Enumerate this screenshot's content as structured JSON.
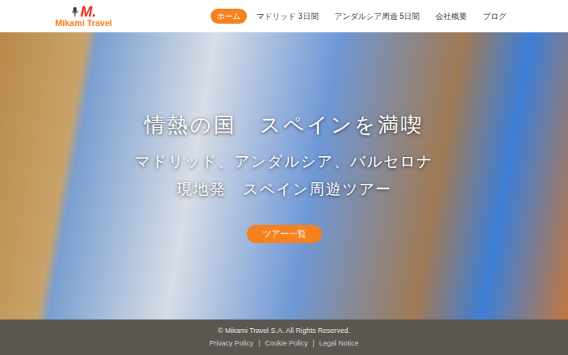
{
  "logo": {
    "mark": "M.",
    "name": "Mikami Travel"
  },
  "nav": [
    {
      "label": "ホーム",
      "selected": true
    },
    {
      "label": "マドリッド 3日間",
      "selected": false
    },
    {
      "label": "アンダルシア周遊 5日間",
      "selected": false
    },
    {
      "label": "会社概要",
      "selected": false
    },
    {
      "label": "ブログ",
      "selected": false
    }
  ],
  "hero": {
    "title": "情熱の国　スペインを満喫",
    "lines": [
      "マドリッド、アンダルシア、バルセロナ",
      "現地発　スペイン周遊ツアー"
    ],
    "button": "ツアー一覧"
  },
  "footer": {
    "copyright": "© Mikami Travel S.A. All Rights Reserved.",
    "links": [
      "Privacy Policy",
      "Cookie Policy",
      "Legal Notice"
    ],
    "separator": "|"
  }
}
